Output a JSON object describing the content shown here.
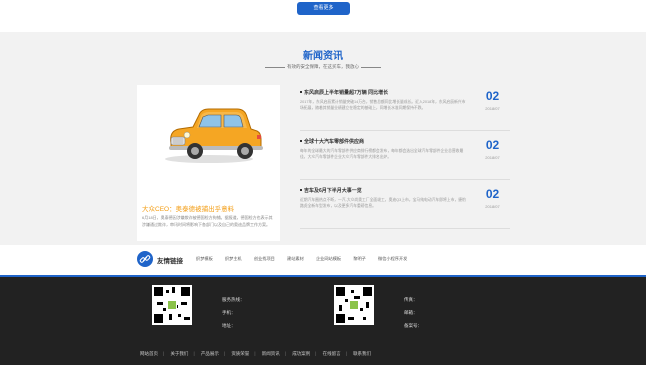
{
  "top": {
    "more_label": "查看更多"
  },
  "news": {
    "title": "新闻资讯",
    "subtitle": "有效的安全保障，在这买车，我放心",
    "feature": {
      "title": "大众CEO：奥泰德被捕出乎意料",
      "text": "6月18日，奥泰德因涉嫌欺诈被德国检方拘捕。据报道，德国检方也表示其涉嫌通过欺诈，审讯时间将影响下各部门以及自己的奥迪品牌工作方案。",
      "more": "查看详情 »"
    },
    "items": [
      {
        "title": "东风启辰上半年销量超7万辆 同比增长",
        "desc": "2017年，东风启辰累计销量突破14万台，销售总额同比增长量成长。近入2018年，东风启辰新兴市场拓展，随着其销量业绩建立在稳定的基础上，同增长水准同期保持不跌。",
        "day": "02",
        "ym": "2018/07"
      },
      {
        "title": "全球十大汽车零部件供应商",
        "desc": "每年的全球最大的汽车零部件供应商排行榜都会发布，每年都会选出全球汽车零部件企业总营收最佳，大众汽车零部件企业大众汽车零部件大排名出炉。",
        "day": "02",
        "ym": "2018/07"
      },
      {
        "title": "吉车及6月下半月大事一览",
        "desc": "近期汽车圈热点不断，一汽-大众尚奥工厂全面竣工，奥迪Q3上市，宝马纯电动汽车即将上市，捷豹路虎全新车型发布，以及更多汽车重磅信息。",
        "day": "02",
        "ym": "2018/07"
      }
    ]
  },
  "friend_links": {
    "label": "友情链接",
    "links": [
      "织梦模板",
      "织梦主机",
      "创业找项目",
      "建站素材",
      "企业网站模板",
      "黎明子",
      "微信小程序开发"
    ]
  },
  "footer": {
    "contact_left": [
      "服务热线：",
      "手机：",
      "地址："
    ],
    "contact_right": [
      "传真：",
      "邮箱：",
      "备案号："
    ],
    "nav": [
      "网站首页",
      "关于我们",
      "产品展示",
      "资质荣誉",
      "新闻资讯",
      "成功案例",
      "在线留言",
      "联系我们"
    ]
  },
  "colors": {
    "accent": "#1f64c9",
    "highlight": "#f39c12",
    "footer_bg": "#222222"
  }
}
